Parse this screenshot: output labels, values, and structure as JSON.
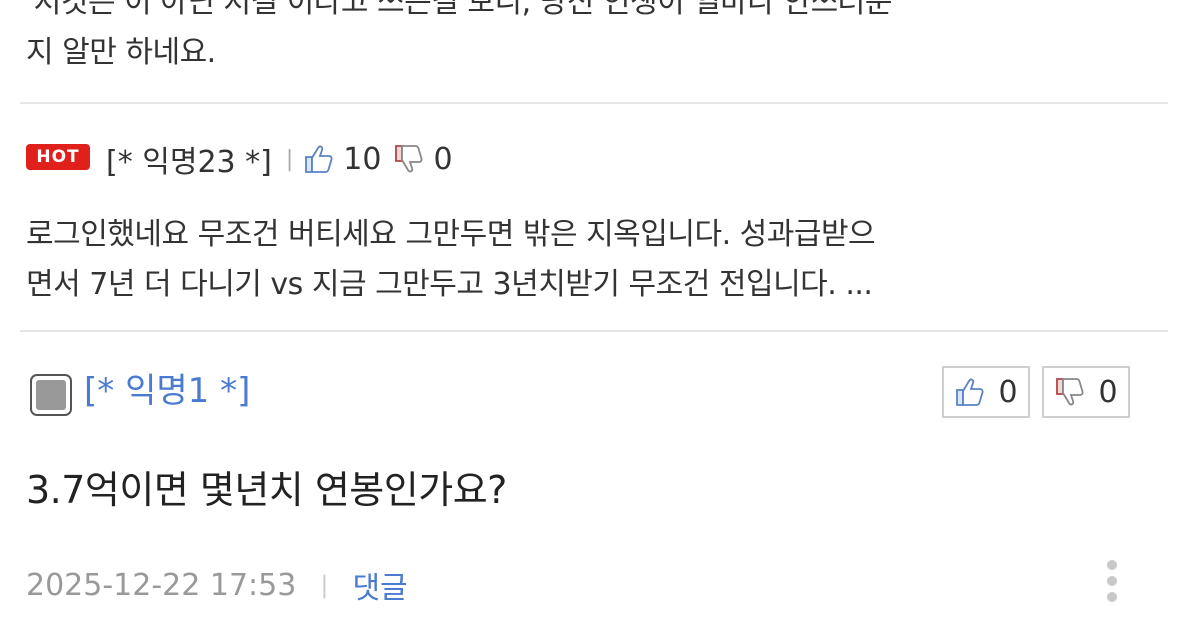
{
  "prev_comment": {
    "text_line1": "'저것은 이 아닌 저걸 이라고 쓰는걸 보니, 당신 인생이 얼마나 안쓰러운",
    "text_line2": "지 알만 하네요."
  },
  "hot_comment": {
    "badge": "HOT",
    "author": "[* 익명23 *]",
    "separator": "|",
    "like_count": "10",
    "dislike_count": "0",
    "text_line1": "로그인했네요 무조건 버티세요 그만두면 밖은 지옥입니다. 성과급받으",
    "text_line2": "면서 7년 더 다니기 vs 지금 그만두고 3년치받기 무조건 전입니다. ..."
  },
  "main_comment": {
    "author": "[* 익명1 *]",
    "like_count": "0",
    "dislike_count": "0",
    "text": "3.7억이면 몇년치 연봉인가요?",
    "date": "2025-12-22 17:53",
    "separator": "|",
    "reply_label": "댓글"
  },
  "colors": {
    "hot_badge": "#e0201b",
    "author_link": "#4a7bd0",
    "divider": "#e6e6e6"
  },
  "icons": [
    "thumb-up-icon",
    "thumb-down-icon",
    "checkbox-icon",
    "more-vertical-icon"
  ]
}
